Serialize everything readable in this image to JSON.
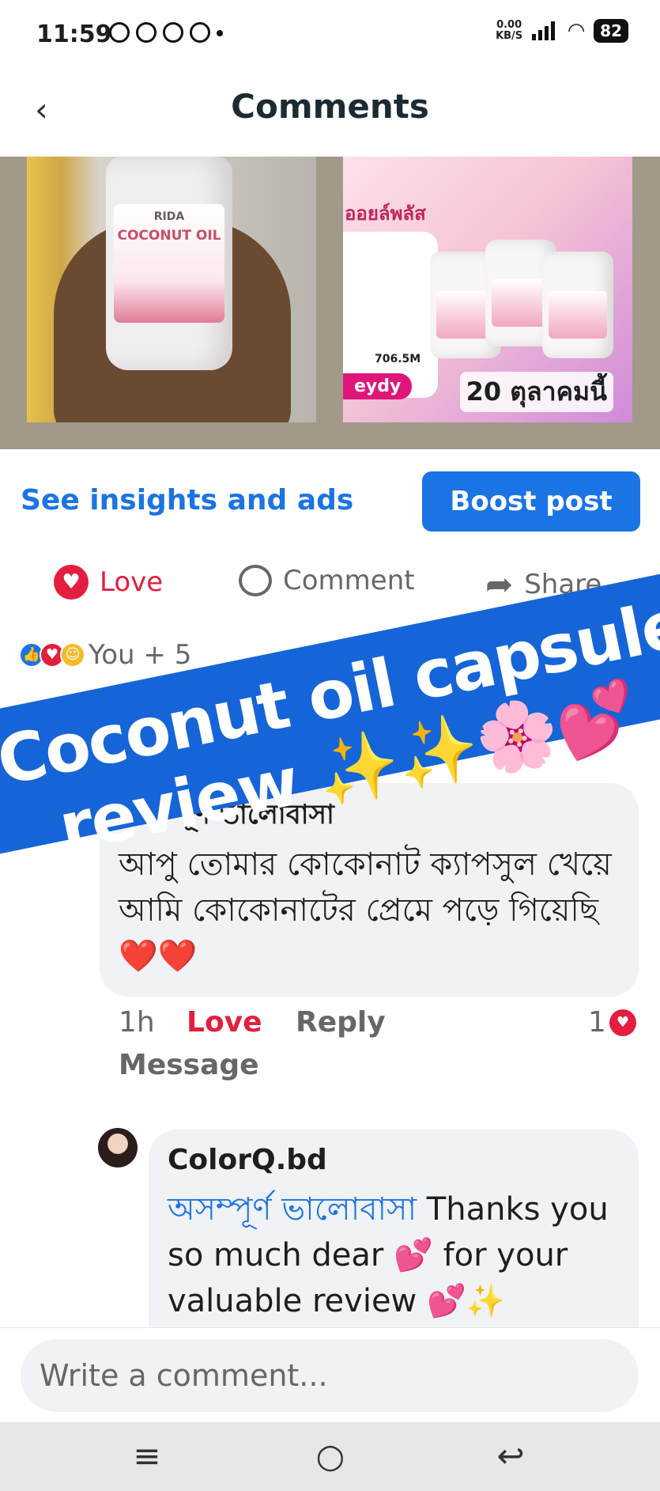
{
  "status_bar": {
    "time": "11:59",
    "net_speed_value": "0.00",
    "net_speed_unit": "KB/S",
    "battery": "82"
  },
  "header": {
    "title": "Comments",
    "back_icon": "chevron-left-icon"
  },
  "post_media": {
    "left_bottle_brand": "RIDA",
    "left_bottle_name": "COCONUT OIL",
    "right_promo_top": "ออยล์พลัส",
    "right_promo_count": "706.5M",
    "right_promo_name": "eydy",
    "right_promo_date": "20 ตุลาคมนี้"
  },
  "insights": {
    "link_label": "See insights and ads",
    "boost_label": "Boost post"
  },
  "actions": {
    "love_label": "Love",
    "comment_label": "Comment",
    "share_label": "Share"
  },
  "reactions": {
    "summary": "You + 5"
  },
  "overlay": {
    "line1": "Coconut oil capsule",
    "line2": "review ✨✨🌸💕"
  },
  "comments": [
    {
      "author": "অসম্পূর্ণ ভালোবাসা",
      "text": "আপু তোমার কোকোনাট ক্যাপসুল খেয়ে আমি কোকোনাটের প্রেমে পড়ে গিয়েছি ❤️❤️",
      "time": "1h",
      "love_label": "Love",
      "reply_label": "Reply",
      "message_label": "Message",
      "reaction_count": "1"
    }
  ],
  "reply": {
    "author": "ColorQ.bd",
    "mention": "অসম্পূর্ণ ভালোবাসা",
    "text": " Thanks you so much dear 💕 for your valuable review 💕✨"
  },
  "composer": {
    "placeholder": "Write a comment..."
  },
  "nav_bar": {
    "menu_icon": "≡",
    "home_icon": "○",
    "back_icon": "↩"
  },
  "colors": {
    "accent": "#1b74e4",
    "love": "#e41e3f",
    "banner": "#1565d8"
  }
}
